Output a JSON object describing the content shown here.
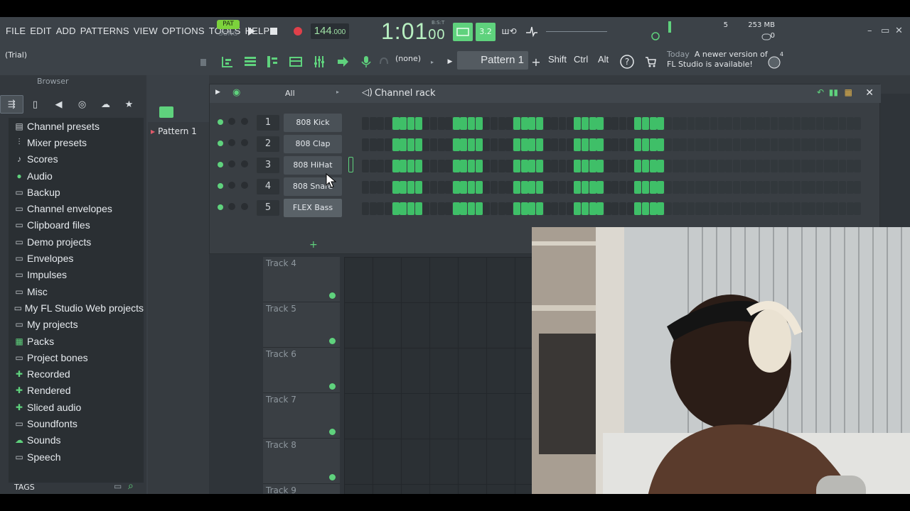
{
  "menu": [
    "FILE",
    "EDIT",
    "ADD",
    "PATTERNS",
    "VIEW",
    "OPTIONS",
    "TOOLS",
    "HELP"
  ],
  "transport": {
    "pat_label": "PAT",
    "song_label": "SONG",
    "tempo": "144",
    "tempo_decimal": ".000",
    "time_main": "1:01",
    "time_sub": "00",
    "time_small": "B:S:T",
    "extra_label": "3.2"
  },
  "monitor": {
    "cpu": "5",
    "memory": "253 MB",
    "poly": "0"
  },
  "trial": "(Trial)",
  "toolbar2": {
    "none_label": "(none)",
    "pattern_label": "Pattern 1",
    "shift": "Shift",
    "ctrl": "Ctrl",
    "alt": "Alt"
  },
  "news": {
    "today": "Today",
    "line1": "A newer version of",
    "line2": "FL Studio is available!",
    "badge": "4"
  },
  "browser": {
    "title": "Browser",
    "items": [
      {
        "label": "Channel presets",
        "icon": "preset-icon"
      },
      {
        "label": "Mixer presets",
        "icon": "mixer-icon"
      },
      {
        "label": "Scores",
        "icon": "note-icon"
      },
      {
        "label": "Audio",
        "icon": "person-icon"
      },
      {
        "label": "Backup",
        "icon": "folder-icon"
      },
      {
        "label": "Channel envelopes",
        "icon": "folder-icon"
      },
      {
        "label": "Clipboard files",
        "icon": "folder-icon"
      },
      {
        "label": "Demo projects",
        "icon": "folder-icon"
      },
      {
        "label": "Envelopes",
        "icon": "folder-icon"
      },
      {
        "label": "Impulses",
        "icon": "folder-icon"
      },
      {
        "label": "Misc",
        "icon": "folder-icon"
      },
      {
        "label": "My FL Studio Web projects",
        "icon": "folder-icon"
      },
      {
        "label": "My projects",
        "icon": "folder-icon"
      },
      {
        "label": "Packs",
        "icon": "packs-icon"
      },
      {
        "label": "Project bones",
        "icon": "folder-icon"
      },
      {
        "label": "Recorded",
        "icon": "plus-icon"
      },
      {
        "label": "Rendered",
        "icon": "plus-icon"
      },
      {
        "label": "Sliced audio",
        "icon": "plus-icon"
      },
      {
        "label": "Soundfonts",
        "icon": "folder-icon"
      },
      {
        "label": "Sounds",
        "icon": "cloud-icon"
      },
      {
        "label": "Speech",
        "icon": "folder-icon"
      }
    ],
    "tags": "TAGS"
  },
  "pattern_list": {
    "item": "Pattern 1"
  },
  "channel_rack": {
    "filter": "All",
    "title": "Channel rack",
    "add": "+",
    "channels": [
      {
        "num": "1",
        "name": "808 Kick"
      },
      {
        "num": "2",
        "name": "808 Clap"
      },
      {
        "num": "3",
        "name": "808 HiHat"
      },
      {
        "num": "4",
        "name": "808 Snare"
      },
      {
        "num": "5",
        "name": "FLEX Bass"
      }
    ],
    "steps_on": [
      5,
      6,
      7,
      8,
      13,
      14,
      15,
      16,
      21,
      22,
      23,
      24,
      29,
      30,
      31,
      32,
      37,
      38,
      39,
      40
    ]
  },
  "playlist": {
    "tracks": [
      "Track 4",
      "Track 5",
      "Track 6",
      "Track 7",
      "Track 8",
      "Track 9"
    ]
  },
  "colors": {
    "accent": "#5fd27d",
    "step_on": "#3fbf68",
    "pattern_marker": "#e05a6a"
  }
}
